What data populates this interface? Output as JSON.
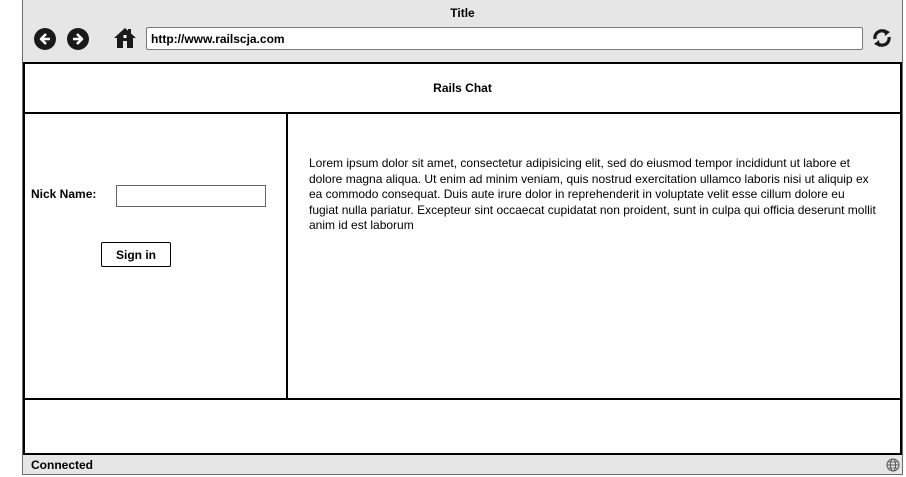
{
  "window": {
    "title": "Title"
  },
  "toolbar": {
    "back_icon": "arrow-left-circle-icon",
    "forward_icon": "arrow-right-circle-icon",
    "home_icon": "home-icon",
    "url": "http://www.railscja.com",
    "refresh_icon": "refresh-icon"
  },
  "page": {
    "header_title": "Rails Chat",
    "login": {
      "nick_label": "Nick Name:",
      "nick_value": "",
      "signin_label": "Sign in"
    },
    "content_text": "Lorem ipsum dolor sit amet, consectetur adipisicing elit, sed do eiusmod tempor incididunt ut labore et dolore magna aliqua. Ut enim ad minim veniam, quis nostrud exercitation ullamco laboris nisi ut aliquip ex ea commodo consequat. Duis aute irure dolor in reprehenderit in voluptate velit esse cillum dolore eu fugiat nulla pariatur. Excepteur sint occaecat cupidatat non proident, sunt in culpa qui officia deserunt mollit anim id est laborum"
  },
  "status": {
    "text": "Connected",
    "icon": "globe-icon"
  },
  "colors": {
    "chrome": "#e6e6e6",
    "border": "#000000",
    "icon": "#1a1a1a"
  }
}
